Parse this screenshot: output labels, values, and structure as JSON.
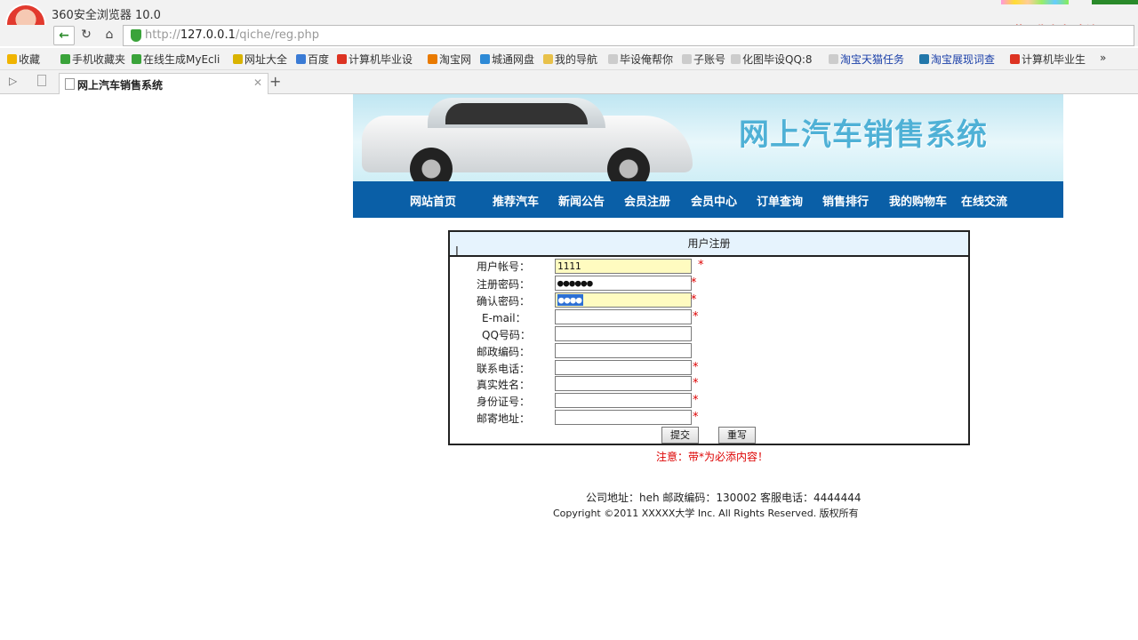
{
  "browser": {
    "window_title": "360安全浏览器 10.0",
    "recorder_label": "屏幕录像专家  未注册",
    "url_scheme": "http://",
    "url_host": "127.0.0.1",
    "url_path": "/qiche/reg.php",
    "bookmarks": [
      "收藏",
      "手机收藏夹",
      "在线生成MyEcli",
      "网址大全",
      "百度",
      "计算机毕业设",
      "淘宝网",
      "城通网盘",
      "我的导航",
      "毕设俺帮你",
      "子账号",
      "化图毕设QQ:8",
      "淘宝天猫任务",
      "淘宝展现词查",
      "计算机毕业生"
    ],
    "tab_title": "网上汽车销售系统"
  },
  "site": {
    "title": "网上汽车销售系统",
    "nav": [
      "网站首页",
      "推荐汽车",
      "新闻公告",
      "会员注册",
      "会员中心",
      "订单查询",
      "销售排行",
      "我的购物车",
      "在线交流"
    ]
  },
  "form": {
    "heading": "用户注册",
    "fields": {
      "username": {
        "label": "用户帐号：",
        "value": "1111"
      },
      "password": {
        "label": "注册密码：",
        "value": "●●●●●●"
      },
      "confirm": {
        "label": "确认密码：",
        "value": "●●●●"
      },
      "email": {
        "label": "E-mail：",
        "value": ""
      },
      "qq": {
        "label": "QQ号码：",
        "value": ""
      },
      "zip": {
        "label": "邮政编码：",
        "value": ""
      },
      "phone": {
        "label": "联系电话：",
        "value": ""
      },
      "name": {
        "label": "真实姓名：",
        "value": ""
      },
      "idcard": {
        "label": "身份证号：",
        "value": ""
      },
      "address": {
        "label": "邮寄地址：",
        "value": ""
      }
    },
    "required_mark": "*",
    "submit_label": "提交",
    "reset_label": "重写",
    "note": "注意：带*为必添内容！"
  },
  "footer": {
    "line1": "公司地址：heh  邮政编码：130002 客服电话：4444444",
    "line2": "Copyright ©2011 XXXXX大学 Inc. All Rights Reserved. 版权所有"
  }
}
